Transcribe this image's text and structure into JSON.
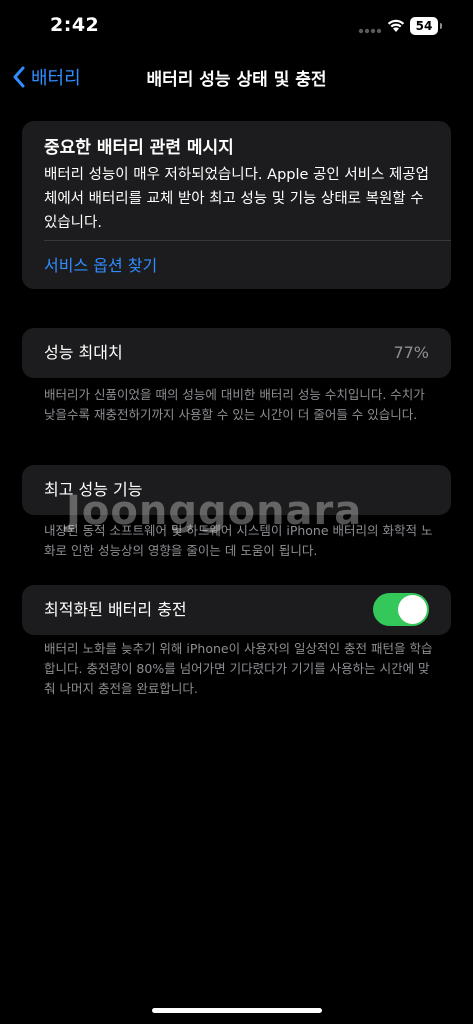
{
  "status_bar": {
    "time": "2:42",
    "battery_level": "54"
  },
  "nav": {
    "back_label": "배터리",
    "title": "배터리 성능 상태 및 충전"
  },
  "message_card": {
    "title": "중요한 배터리 관련 메시지",
    "body": "배터리 성능이 매우 저하되었습니다. Apple 공인 서비스 제공업체에서 배터리를 교체 받아 최고 성능 및 기능 상태로 복원할 수 있습니다.",
    "link": "서비스 옵션 찾기"
  },
  "max_capacity": {
    "label": "성능 최대치",
    "value": "77%",
    "footnote": "배터리가 신품이었을 때의 성능에 대비한 배터리 성능 수치입니다. 수치가 낮을수록 재충전하기까지 사용할 수 있는 시간이 더 줄어들 수 있습니다."
  },
  "peak_performance": {
    "label": "최고 성능 기능",
    "footnote": "내장된 동적 소프트웨어 및 하드웨어 시스템이 iPhone 배터리의 화학적 노화로 인한 성능상의 영향을 줄이는 데 도움이 됩니다."
  },
  "optimized_charging": {
    "label": "최적화된 배터리 충전",
    "enabled": true,
    "footnote": "배터리 노화를 늦추기 위해 iPhone이 사용자의 일상적인 충전 패턴을 학습합니다. 충전량이 80%를 넘어가면 기다렸다가 기기를 사용하는 시간에 맞춰 나머지 충전을 완료합니다."
  },
  "watermark": "Joonggonara",
  "colors": {
    "background": "#000000",
    "card": "#1c1c1e",
    "accent": "#2f8dff",
    "toggle_on": "#34c759",
    "secondary_text": "#8e8e93"
  }
}
